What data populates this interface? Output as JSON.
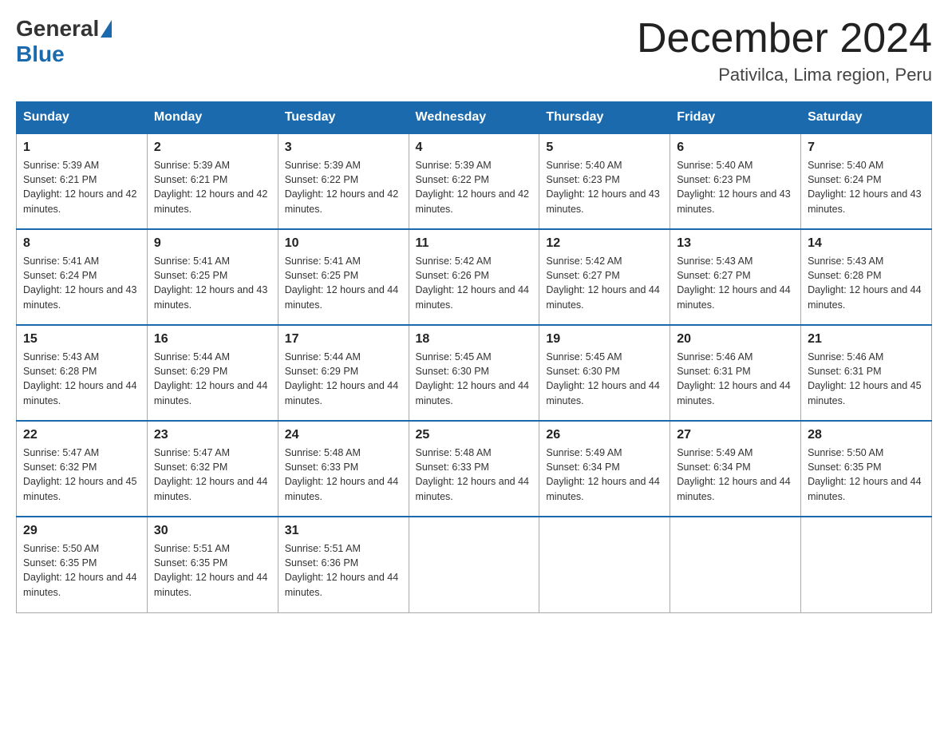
{
  "logo": {
    "general": "General",
    "blue": "Blue"
  },
  "title": "December 2024",
  "location": "Pativilca, Lima region, Peru",
  "days_of_week": [
    "Sunday",
    "Monday",
    "Tuesday",
    "Wednesday",
    "Thursday",
    "Friday",
    "Saturday"
  ],
  "weeks": [
    [
      {
        "day": "1",
        "sunrise": "5:39 AM",
        "sunset": "6:21 PM",
        "daylight": "12 hours and 42 minutes."
      },
      {
        "day": "2",
        "sunrise": "5:39 AM",
        "sunset": "6:21 PM",
        "daylight": "12 hours and 42 minutes."
      },
      {
        "day": "3",
        "sunrise": "5:39 AM",
        "sunset": "6:22 PM",
        "daylight": "12 hours and 42 minutes."
      },
      {
        "day": "4",
        "sunrise": "5:39 AM",
        "sunset": "6:22 PM",
        "daylight": "12 hours and 42 minutes."
      },
      {
        "day": "5",
        "sunrise": "5:40 AM",
        "sunset": "6:23 PM",
        "daylight": "12 hours and 43 minutes."
      },
      {
        "day": "6",
        "sunrise": "5:40 AM",
        "sunset": "6:23 PM",
        "daylight": "12 hours and 43 minutes."
      },
      {
        "day": "7",
        "sunrise": "5:40 AM",
        "sunset": "6:24 PM",
        "daylight": "12 hours and 43 minutes."
      }
    ],
    [
      {
        "day": "8",
        "sunrise": "5:41 AM",
        "sunset": "6:24 PM",
        "daylight": "12 hours and 43 minutes."
      },
      {
        "day": "9",
        "sunrise": "5:41 AM",
        "sunset": "6:25 PM",
        "daylight": "12 hours and 43 minutes."
      },
      {
        "day": "10",
        "sunrise": "5:41 AM",
        "sunset": "6:25 PM",
        "daylight": "12 hours and 44 minutes."
      },
      {
        "day": "11",
        "sunrise": "5:42 AM",
        "sunset": "6:26 PM",
        "daylight": "12 hours and 44 minutes."
      },
      {
        "day": "12",
        "sunrise": "5:42 AM",
        "sunset": "6:27 PM",
        "daylight": "12 hours and 44 minutes."
      },
      {
        "day": "13",
        "sunrise": "5:43 AM",
        "sunset": "6:27 PM",
        "daylight": "12 hours and 44 minutes."
      },
      {
        "day": "14",
        "sunrise": "5:43 AM",
        "sunset": "6:28 PM",
        "daylight": "12 hours and 44 minutes."
      }
    ],
    [
      {
        "day": "15",
        "sunrise": "5:43 AM",
        "sunset": "6:28 PM",
        "daylight": "12 hours and 44 minutes."
      },
      {
        "day": "16",
        "sunrise": "5:44 AM",
        "sunset": "6:29 PM",
        "daylight": "12 hours and 44 minutes."
      },
      {
        "day": "17",
        "sunrise": "5:44 AM",
        "sunset": "6:29 PM",
        "daylight": "12 hours and 44 minutes."
      },
      {
        "day": "18",
        "sunrise": "5:45 AM",
        "sunset": "6:30 PM",
        "daylight": "12 hours and 44 minutes."
      },
      {
        "day": "19",
        "sunrise": "5:45 AM",
        "sunset": "6:30 PM",
        "daylight": "12 hours and 44 minutes."
      },
      {
        "day": "20",
        "sunrise": "5:46 AM",
        "sunset": "6:31 PM",
        "daylight": "12 hours and 44 minutes."
      },
      {
        "day": "21",
        "sunrise": "5:46 AM",
        "sunset": "6:31 PM",
        "daylight": "12 hours and 45 minutes."
      }
    ],
    [
      {
        "day": "22",
        "sunrise": "5:47 AM",
        "sunset": "6:32 PM",
        "daylight": "12 hours and 45 minutes."
      },
      {
        "day": "23",
        "sunrise": "5:47 AM",
        "sunset": "6:32 PM",
        "daylight": "12 hours and 44 minutes."
      },
      {
        "day": "24",
        "sunrise": "5:48 AM",
        "sunset": "6:33 PM",
        "daylight": "12 hours and 44 minutes."
      },
      {
        "day": "25",
        "sunrise": "5:48 AM",
        "sunset": "6:33 PM",
        "daylight": "12 hours and 44 minutes."
      },
      {
        "day": "26",
        "sunrise": "5:49 AM",
        "sunset": "6:34 PM",
        "daylight": "12 hours and 44 minutes."
      },
      {
        "day": "27",
        "sunrise": "5:49 AM",
        "sunset": "6:34 PM",
        "daylight": "12 hours and 44 minutes."
      },
      {
        "day": "28",
        "sunrise": "5:50 AM",
        "sunset": "6:35 PM",
        "daylight": "12 hours and 44 minutes."
      }
    ],
    [
      {
        "day": "29",
        "sunrise": "5:50 AM",
        "sunset": "6:35 PM",
        "daylight": "12 hours and 44 minutes."
      },
      {
        "day": "30",
        "sunrise": "5:51 AM",
        "sunset": "6:35 PM",
        "daylight": "12 hours and 44 minutes."
      },
      {
        "day": "31",
        "sunrise": "5:51 AM",
        "sunset": "6:36 PM",
        "daylight": "12 hours and 44 minutes."
      },
      null,
      null,
      null,
      null
    ]
  ]
}
